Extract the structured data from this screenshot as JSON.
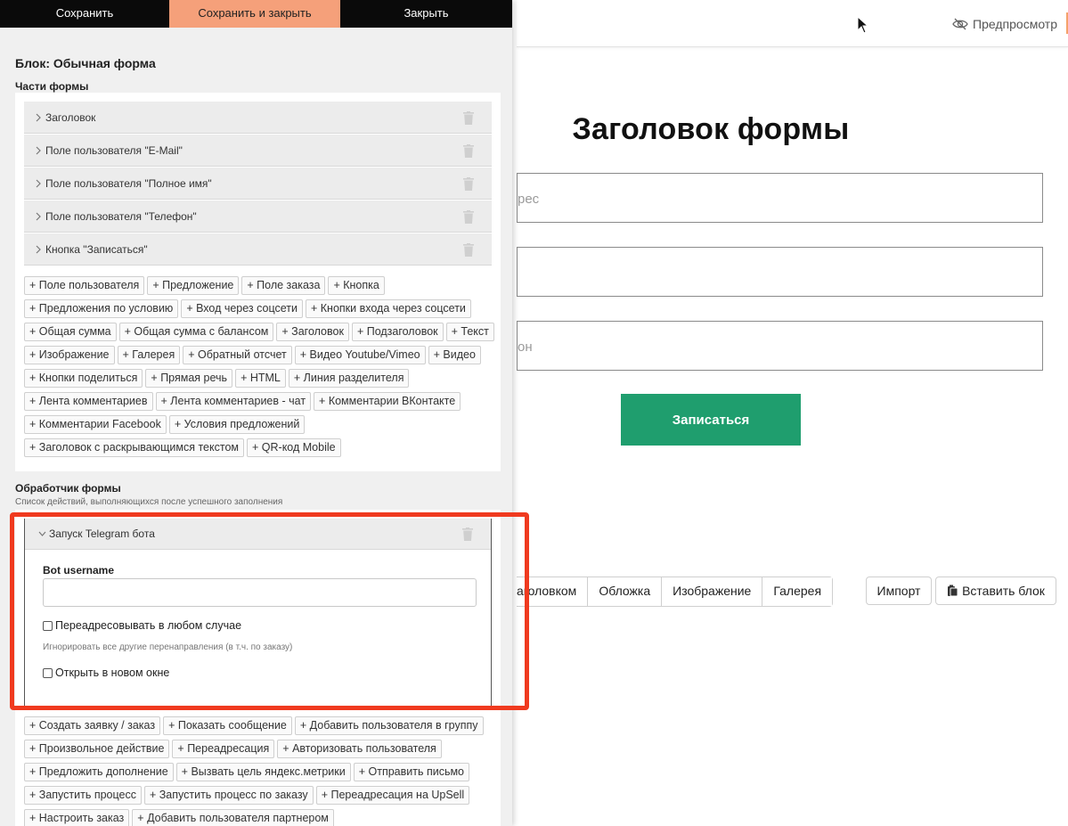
{
  "toolbar": {
    "save_label": "Сохранить",
    "save_close_label": "Сохранить и закрыть",
    "close_label": "Закрыть"
  },
  "editor": {
    "block_title": "Блок: Обычная форма",
    "parts_title": "Части формы",
    "parts": [
      {
        "label": "Заголовок"
      },
      {
        "label": "Поле пользователя \"E-Mail\""
      },
      {
        "label": "Поле пользователя \"Полное имя\""
      },
      {
        "label": "Поле пользователя \"Телефон\""
      },
      {
        "label": "Кнопка \"Записаться\""
      }
    ],
    "add_parts": [
      [
        "+ Поле пользователя",
        "+ Предложение",
        "+ Поле заказа",
        "+ Кнопка"
      ],
      [
        "+ Предложения по условию",
        "+ Вход через соцсети",
        "+ Кнопки входа через соцсети"
      ],
      [
        "+ Общая сумма",
        "+ Общая сумма с балансом",
        "+ Заголовок",
        "+ Подзаголовок",
        "+ Текст"
      ],
      [
        "+ Изображение",
        "+ Галерея",
        "+ Обратный отсчет",
        "+ Видео Youtube/Vimeo",
        "+ Видео"
      ],
      [
        "+ Кнопки поделиться",
        "+ Прямая речь",
        "+ HTML",
        "+ Линия разделителя"
      ],
      [
        "+ Лента комментариев",
        "+ Лента комментариев - чат",
        "+ Комментарии ВКонтакте"
      ],
      [
        "+ Комментарии Facebook",
        "+ Условия предложений"
      ],
      [
        "+ Заголовок с раскрывающимся текстом",
        "+ QR-код Mobile"
      ]
    ],
    "handler_title": "Обработчик формы",
    "handler_subtitle": "Список действий, выполняющихся после успешного заполнения",
    "telegram": {
      "title": "Запуск Telegram бота",
      "field_label": "Bot username",
      "field_value": "",
      "redirect_label": "Переадресовывать в любом случае",
      "redirect_checked": false,
      "redirect_hint": "Игнорировать все другие перенаправления (в т.ч. по заказу)",
      "new_window_label": "Открыть в новом окне",
      "new_window_checked": false
    },
    "add_actions": [
      [
        "+ Создать заявку / заказ",
        "+ Показать сообщение",
        "+ Добавить пользователя в группу"
      ],
      [
        "+ Произвольное действие",
        "+ Переадресация",
        "+ Авторизовать пользователя"
      ],
      [
        "+ Предложить дополнение",
        "+ Вызвать цель яндекс.метрики",
        "+ Отправить письмо"
      ],
      [
        "+ Запустить процесс",
        "+ Запустить процесс по заказу",
        "+ Переадресация на UpSell"
      ],
      [
        "+ Настроить заказ",
        "+ Добавить пользователя партнером"
      ]
    ],
    "highlight_color": "#f03a1f"
  },
  "preview": {
    "preview_label": "Предпросмотр",
    "form_title": "Заголовок формы",
    "inputs": [
      "рес",
      "",
      "он"
    ],
    "submit_label": "Записаться",
    "submit_color": "#1f9e6e",
    "add_blocks": [
      "аголовком",
      "Обложка",
      "Изображение",
      "Галерея"
    ],
    "import_label": "Импорт",
    "paste_label": "Вставить блок"
  }
}
